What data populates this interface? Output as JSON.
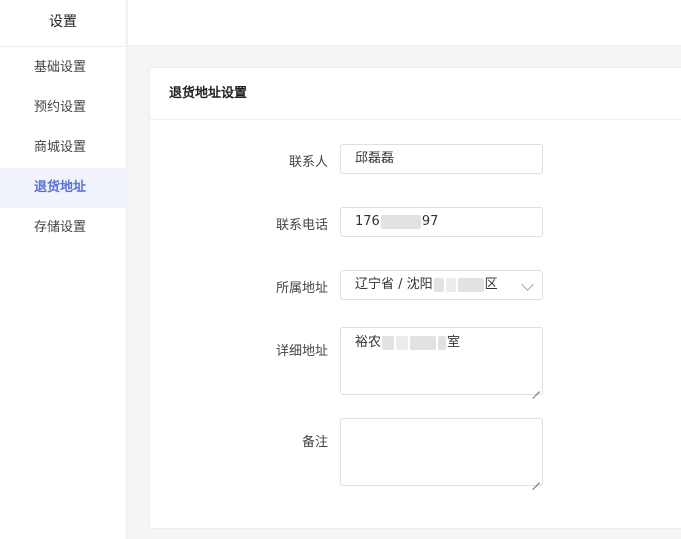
{
  "sidebar": {
    "title": "设置",
    "items": [
      {
        "label": "基础设置",
        "active": false
      },
      {
        "label": "预约设置",
        "active": false
      },
      {
        "label": "商城设置",
        "active": false
      },
      {
        "label": "退货地址",
        "active": true
      },
      {
        "label": "存储设置",
        "active": false
      }
    ]
  },
  "form": {
    "title": "退货地址设置",
    "contact": {
      "label": "联系人",
      "value": "邱磊磊"
    },
    "phone": {
      "label": "联系电话",
      "value_prefix": "176",
      "value_suffix": "97"
    },
    "region": {
      "label": "所属地址",
      "value_prefix": "辽宁省 / 沈阳",
      "value_suffix": "区",
      "icon": "chevron-down-icon"
    },
    "detail": {
      "label": "详细地址",
      "value_prefix": "裕农",
      "value_suffix": "室"
    },
    "note": {
      "label": "备注",
      "value": ""
    }
  },
  "colors": {
    "accent": "#5b70d8",
    "active_bg": "#f0f3fc",
    "border": "#dcdfe6"
  }
}
